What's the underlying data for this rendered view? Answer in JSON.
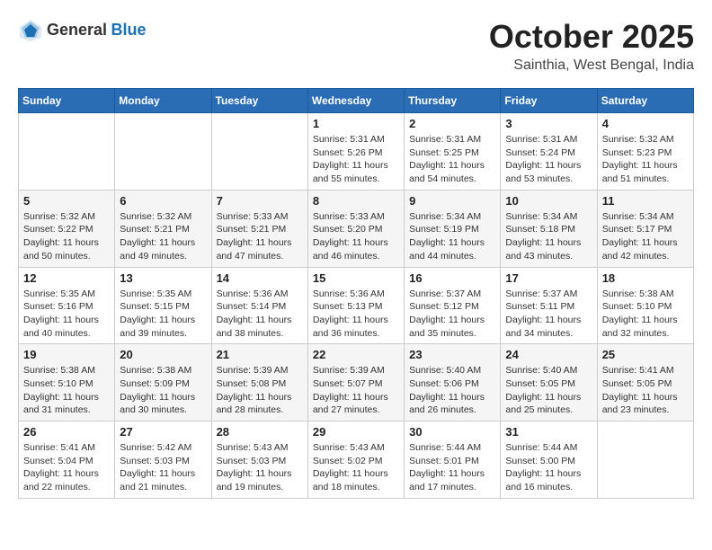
{
  "logo": {
    "text_general": "General",
    "text_blue": "Blue"
  },
  "title": {
    "month": "October 2025",
    "location": "Sainthia, West Bengal, India"
  },
  "headers": [
    "Sunday",
    "Monday",
    "Tuesday",
    "Wednesday",
    "Thursday",
    "Friday",
    "Saturday"
  ],
  "weeks": [
    [
      {
        "day": "",
        "info": ""
      },
      {
        "day": "",
        "info": ""
      },
      {
        "day": "",
        "info": ""
      },
      {
        "day": "1",
        "info": "Sunrise: 5:31 AM\nSunset: 5:26 PM\nDaylight: 11 hours\nand 55 minutes."
      },
      {
        "day": "2",
        "info": "Sunrise: 5:31 AM\nSunset: 5:25 PM\nDaylight: 11 hours\nand 54 minutes."
      },
      {
        "day": "3",
        "info": "Sunrise: 5:31 AM\nSunset: 5:24 PM\nDaylight: 11 hours\nand 53 minutes."
      },
      {
        "day": "4",
        "info": "Sunrise: 5:32 AM\nSunset: 5:23 PM\nDaylight: 11 hours\nand 51 minutes."
      }
    ],
    [
      {
        "day": "5",
        "info": "Sunrise: 5:32 AM\nSunset: 5:22 PM\nDaylight: 11 hours\nand 50 minutes."
      },
      {
        "day": "6",
        "info": "Sunrise: 5:32 AM\nSunset: 5:21 PM\nDaylight: 11 hours\nand 49 minutes."
      },
      {
        "day": "7",
        "info": "Sunrise: 5:33 AM\nSunset: 5:21 PM\nDaylight: 11 hours\nand 47 minutes."
      },
      {
        "day": "8",
        "info": "Sunrise: 5:33 AM\nSunset: 5:20 PM\nDaylight: 11 hours\nand 46 minutes."
      },
      {
        "day": "9",
        "info": "Sunrise: 5:34 AM\nSunset: 5:19 PM\nDaylight: 11 hours\nand 44 minutes."
      },
      {
        "day": "10",
        "info": "Sunrise: 5:34 AM\nSunset: 5:18 PM\nDaylight: 11 hours\nand 43 minutes."
      },
      {
        "day": "11",
        "info": "Sunrise: 5:34 AM\nSunset: 5:17 PM\nDaylight: 11 hours\nand 42 minutes."
      }
    ],
    [
      {
        "day": "12",
        "info": "Sunrise: 5:35 AM\nSunset: 5:16 PM\nDaylight: 11 hours\nand 40 minutes."
      },
      {
        "day": "13",
        "info": "Sunrise: 5:35 AM\nSunset: 5:15 PM\nDaylight: 11 hours\nand 39 minutes."
      },
      {
        "day": "14",
        "info": "Sunrise: 5:36 AM\nSunset: 5:14 PM\nDaylight: 11 hours\nand 38 minutes."
      },
      {
        "day": "15",
        "info": "Sunrise: 5:36 AM\nSunset: 5:13 PM\nDaylight: 11 hours\nand 36 minutes."
      },
      {
        "day": "16",
        "info": "Sunrise: 5:37 AM\nSunset: 5:12 PM\nDaylight: 11 hours\nand 35 minutes."
      },
      {
        "day": "17",
        "info": "Sunrise: 5:37 AM\nSunset: 5:11 PM\nDaylight: 11 hours\nand 34 minutes."
      },
      {
        "day": "18",
        "info": "Sunrise: 5:38 AM\nSunset: 5:10 PM\nDaylight: 11 hours\nand 32 minutes."
      }
    ],
    [
      {
        "day": "19",
        "info": "Sunrise: 5:38 AM\nSunset: 5:10 PM\nDaylight: 11 hours\nand 31 minutes."
      },
      {
        "day": "20",
        "info": "Sunrise: 5:38 AM\nSunset: 5:09 PM\nDaylight: 11 hours\nand 30 minutes."
      },
      {
        "day": "21",
        "info": "Sunrise: 5:39 AM\nSunset: 5:08 PM\nDaylight: 11 hours\nand 28 minutes."
      },
      {
        "day": "22",
        "info": "Sunrise: 5:39 AM\nSunset: 5:07 PM\nDaylight: 11 hours\nand 27 minutes."
      },
      {
        "day": "23",
        "info": "Sunrise: 5:40 AM\nSunset: 5:06 PM\nDaylight: 11 hours\nand 26 minutes."
      },
      {
        "day": "24",
        "info": "Sunrise: 5:40 AM\nSunset: 5:05 PM\nDaylight: 11 hours\nand 25 minutes."
      },
      {
        "day": "25",
        "info": "Sunrise: 5:41 AM\nSunset: 5:05 PM\nDaylight: 11 hours\nand 23 minutes."
      }
    ],
    [
      {
        "day": "26",
        "info": "Sunrise: 5:41 AM\nSunset: 5:04 PM\nDaylight: 11 hours\nand 22 minutes."
      },
      {
        "day": "27",
        "info": "Sunrise: 5:42 AM\nSunset: 5:03 PM\nDaylight: 11 hours\nand 21 minutes."
      },
      {
        "day": "28",
        "info": "Sunrise: 5:43 AM\nSunset: 5:03 PM\nDaylight: 11 hours\nand 19 minutes."
      },
      {
        "day": "29",
        "info": "Sunrise: 5:43 AM\nSunset: 5:02 PM\nDaylight: 11 hours\nand 18 minutes."
      },
      {
        "day": "30",
        "info": "Sunrise: 5:44 AM\nSunset: 5:01 PM\nDaylight: 11 hours\nand 17 minutes."
      },
      {
        "day": "31",
        "info": "Sunrise: 5:44 AM\nSunset: 5:00 PM\nDaylight: 11 hours\nand 16 minutes."
      },
      {
        "day": "",
        "info": ""
      }
    ]
  ]
}
